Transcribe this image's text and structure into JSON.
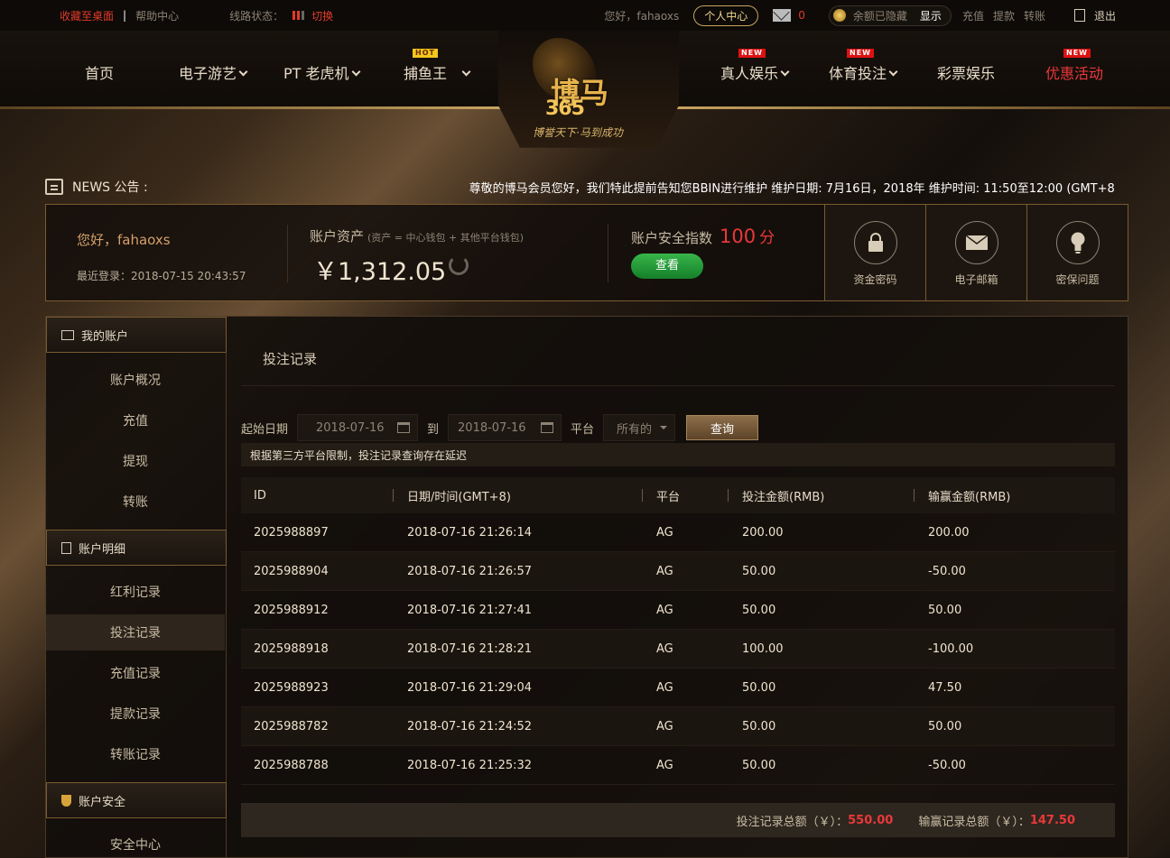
{
  "topbar": {
    "bookmark": "收藏至桌面",
    "help": "帮助中心",
    "line_status": "线路状态：",
    "switch": "切换",
    "greeting": "您好，fahaoxs",
    "personal_center": "个人中心",
    "mail_count": "0",
    "balance_hidden": "余额已隐藏",
    "show": "显示",
    "deposit": "充值",
    "withdraw": "提款",
    "transfer": "转账",
    "logout": "退出"
  },
  "nav": {
    "home": "首页",
    "egames": "电子游艺",
    "pt": "PT 老虎机",
    "fishing": "捕鱼王",
    "live": "真人娱乐",
    "sports": "体育投注",
    "lottery": "彩票娱乐",
    "promo": "优惠活动",
    "badge_hot": "HOT",
    "badge_new": "NEW"
  },
  "logo": {
    "brand": "博马",
    "number": "365",
    "slogan": "博誉天下·马到成功"
  },
  "news": {
    "label": "NEWS 公告 :",
    "text": "尊敬的博马会员您好，我们特此提前告知您BBIN进行维护 维护日期: 7月16日，2018年 维护时间: 11:50至12:00 (GMT+8"
  },
  "account": {
    "hello": "您好，fahaoxs",
    "last_login": "最近登录：2018-07-15 20:43:57",
    "assets_label": "账户资产",
    "assets_note": "(资产 = 中心钱包 + 其他平台钱包)",
    "balance": "￥1,312.05",
    "security_label": "账户安全指数",
    "security_score": "100",
    "security_unit": "分",
    "view": "查看",
    "tiles": [
      "资金密码",
      "电子邮箱",
      "密保问题"
    ]
  },
  "sidebar": {
    "my_account": "我的账户",
    "items1": [
      "账户概况",
      "充值",
      "提现",
      "转账"
    ],
    "details": "账户明细",
    "items2": [
      "红利记录",
      "投注记录",
      "充值记录",
      "提款记录",
      "转账记录"
    ],
    "security": "账户安全",
    "items3": [
      "安全中心"
    ]
  },
  "content": {
    "title": "投注记录",
    "start_label": "起始日期",
    "start_date": "2018-07-16",
    "to": "到",
    "end_date": "2018-07-16",
    "platform_label": "平台",
    "platform_value": "所有的",
    "query": "查询",
    "notice": "根据第三方平台限制，投注记录查询存在延迟"
  },
  "table": {
    "headers": [
      "ID",
      "日期/时间(GMT+8)",
      "平台",
      "投注金额(RMB)",
      "输赢金额(RMB)"
    ],
    "rows": [
      [
        "2025988897",
        "2018-07-16 21:26:14",
        "AG",
        "200.00",
        "200.00"
      ],
      [
        "2025988904",
        "2018-07-16 21:26:57",
        "AG",
        "50.00",
        "-50.00"
      ],
      [
        "2025988912",
        "2018-07-16 21:27:41",
        "AG",
        "50.00",
        "50.00"
      ],
      [
        "2025988918",
        "2018-07-16 21:28:21",
        "AG",
        "100.00",
        "-100.00"
      ],
      [
        "2025988923",
        "2018-07-16 21:29:04",
        "AG",
        "50.00",
        "47.50"
      ],
      [
        "2025988782",
        "2018-07-16 21:24:52",
        "AG",
        "50.00",
        "50.00"
      ],
      [
        "2025988788",
        "2018-07-16 21:25:32",
        "AG",
        "50.00",
        "-50.00"
      ]
    ]
  },
  "totals": {
    "bet_label": "投注记录总额（￥）：",
    "bet_value": "550.00",
    "win_label": "输赢记录总额（￥）：",
    "win_value": "147.50"
  },
  "colors": {
    "accent_gold": "#d9b46a",
    "red": "#e9383a",
    "green": "#15802a"
  }
}
